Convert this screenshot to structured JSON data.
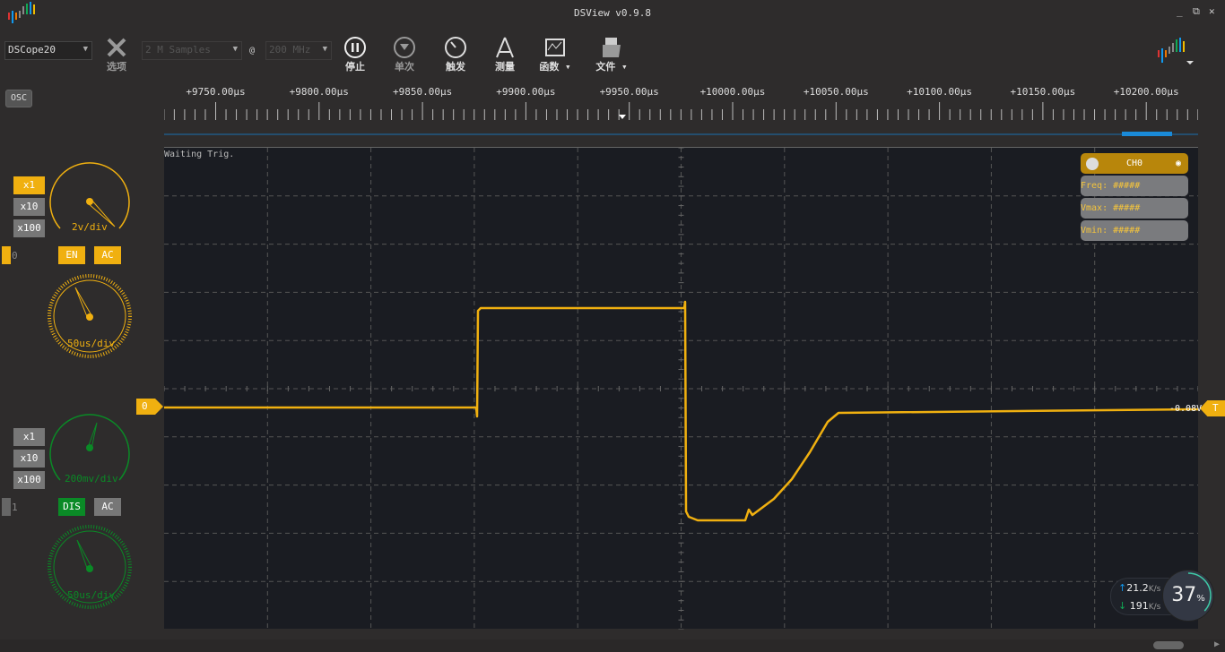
{
  "window": {
    "title": "DSView v0.9.8",
    "minimize": "_",
    "restore": "⧉",
    "close": "✕"
  },
  "toolbar": {
    "device": "DSCope20",
    "options": "选项",
    "samples": "2 M Samples",
    "at": "@",
    "rate": "200 MHz",
    "stop": "停止",
    "single": "单次",
    "trigger": "触发",
    "measure": "测量",
    "math": "函数",
    "file": "文件"
  },
  "mode": "OSC",
  "ruler": {
    "labels": [
      "+9750.00μs",
      "+9800.00μs",
      "+9850.00μs",
      "+9900.00μs",
      "+9950.00μs",
      "+10000.00μs",
      "+10050.00μs",
      "+10100.00μs",
      "+10150.00μs",
      "+10200.00μs"
    ]
  },
  "status": "Waiting Trig.",
  "ch0": {
    "index": "0",
    "probe": [
      "x1",
      "x10",
      "x100"
    ],
    "vdiv": "2v/div",
    "enable": "EN",
    "coupling": "AC",
    "hdiv": "50us/div",
    "marker": "0",
    "color": "#f0b010"
  },
  "ch1": {
    "index": "1",
    "probe": [
      "x1",
      "x10",
      "x100"
    ],
    "vdiv": "200mv/div",
    "enable": "DIS",
    "coupling": "AC",
    "hdiv": "50us/div",
    "color": "#0a8a26"
  },
  "trigger": {
    "marker": "T",
    "level": "-0.08V"
  },
  "measure_panel": {
    "channel": "CH0",
    "freq": "Freq: #####",
    "vmax": "Vmax: #####",
    "vmin": "Vmin: #####"
  },
  "net": {
    "up": "21.2",
    "down": "191",
    "unit": "K/s",
    "cpu": "37",
    "pct": "%"
  }
}
